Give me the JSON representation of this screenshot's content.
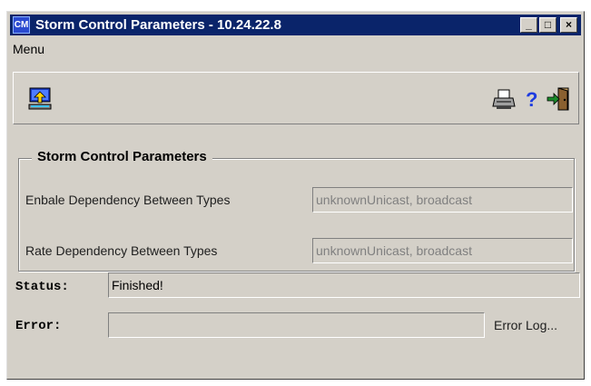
{
  "window": {
    "title": "Storm Control Parameters - 10.24.22.8",
    "app_icon_text": "CM",
    "minimize_label": "_",
    "maximize_label": "□",
    "close_label": "×"
  },
  "menu": {
    "label": "Menu"
  },
  "toolbar": {
    "left_icon": "upload-settings-icon",
    "right_icons": [
      "printer-icon",
      "help-icon",
      "exit-icon"
    ],
    "help_glyph": "?"
  },
  "group": {
    "title": "Storm Control Parameters",
    "fields": [
      {
        "label": "Enbale Dependency Between Types",
        "value": "unknownUnicast, broadcast"
      },
      {
        "label": "Rate Dependency Between Types",
        "value": "unknownUnicast, broadcast"
      }
    ]
  },
  "status": {
    "label": "Status:",
    "value": "Finished!"
  },
  "error": {
    "label": "Error:",
    "value": "",
    "log_label": "Error Log..."
  },
  "colors": {
    "title_bar": "#0a246a",
    "face": "#d4d0c8",
    "help_blue": "#1e3ce0",
    "exit_green": "#1a8a2a"
  }
}
